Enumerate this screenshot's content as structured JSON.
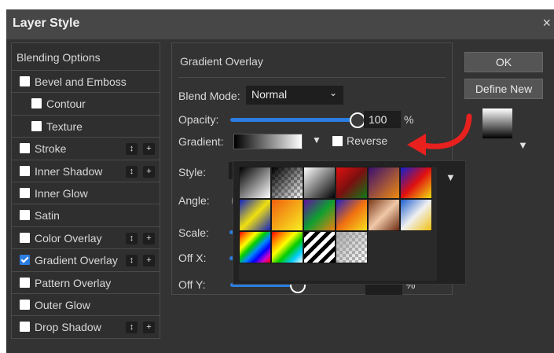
{
  "window": {
    "title": "Layer Style",
    "close_glyph": "×"
  },
  "left_panel": {
    "header": "Blending Options",
    "items": [
      {
        "label": "Bevel and Emboss",
        "checked": false,
        "indent": false,
        "controls": false
      },
      {
        "label": "Contour",
        "checked": false,
        "indent": true,
        "controls": false
      },
      {
        "label": "Texture",
        "checked": false,
        "indent": true,
        "controls": false
      },
      {
        "label": "Stroke",
        "checked": false,
        "indent": false,
        "controls": true
      },
      {
        "label": "Inner Shadow",
        "checked": false,
        "indent": false,
        "controls": true
      },
      {
        "label": "Inner Glow",
        "checked": false,
        "indent": false,
        "controls": false
      },
      {
        "label": "Satin",
        "checked": false,
        "indent": false,
        "controls": false
      },
      {
        "label": "Color Overlay",
        "checked": false,
        "indent": false,
        "controls": true
      },
      {
        "label": "Gradient Overlay",
        "checked": true,
        "indent": false,
        "controls": true
      },
      {
        "label": "Pattern Overlay",
        "checked": false,
        "indent": false,
        "controls": false
      },
      {
        "label": "Outer Glow",
        "checked": false,
        "indent": false,
        "controls": false
      },
      {
        "label": "Drop Shadow",
        "checked": false,
        "indent": false,
        "controls": true
      }
    ],
    "control_glyphs": {
      "move": "↕",
      "add": "+"
    }
  },
  "gradient_overlay": {
    "section_title": "Gradient Overlay",
    "blend_mode_label": "Blend Mode:",
    "blend_mode_value": "Normal",
    "opacity_label": "Opacity:",
    "opacity_value": "100",
    "opacity_unit": "%",
    "opacity_level": 1.0,
    "gradient_label": "Gradient:",
    "reverse_label": "Reverse",
    "reverse_checked": false,
    "style_label": "Style:",
    "angle_label": "Angle:",
    "scale_label": "Scale:",
    "offx_label": "Off X:",
    "offy_label": "Off Y:",
    "offy_unit": "%"
  },
  "buttons": {
    "ok": "OK",
    "define_new": "Define New"
  },
  "gradient_presets": [
    "black-white",
    "checker-black",
    "white-black",
    "red-green",
    "purple-orange",
    "blue-red-yellow",
    "blue-yellow-blue",
    "orange-yellow",
    "purple-green-orange",
    "blue-orange-yellow",
    "copper",
    "blue-yellow-white",
    "spectrum",
    "spectrum-transparent",
    "black-white-stripes",
    "checker-transparent"
  ],
  "colors": {
    "accent": "#2b7de1",
    "annotation_arrow": "#e8201e"
  }
}
